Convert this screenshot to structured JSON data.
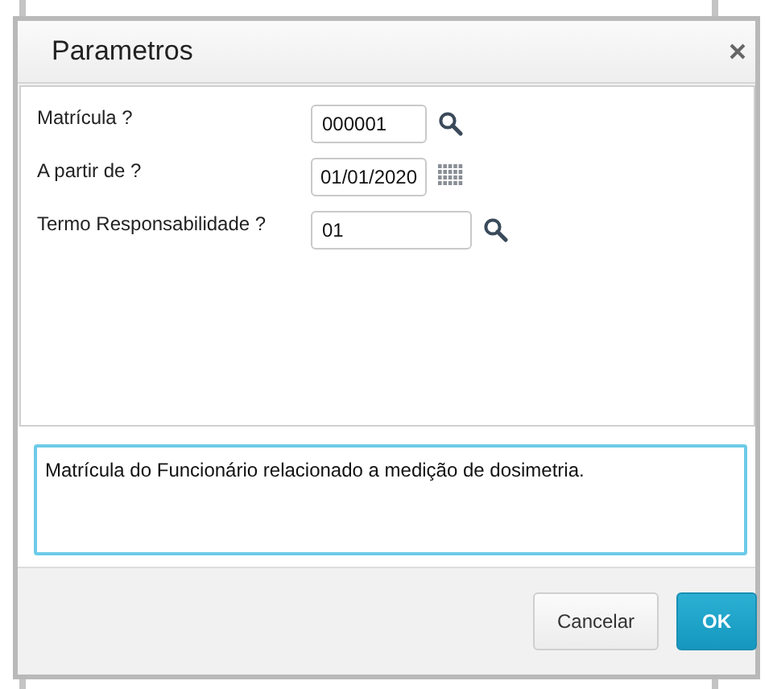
{
  "dialog": {
    "title": "Parametros"
  },
  "parameters": [
    {
      "label": "Matrícula ?",
      "value": "000001",
      "kind": "code"
    },
    {
      "label": "A partir de ?",
      "value": "01/01/2020",
      "kind": "date"
    },
    {
      "label": "Termo Responsabilidade ?",
      "value": "01",
      "kind": "lookup"
    }
  ],
  "help_text": "Matrícula do Funcionário relacionado a medição de dosimetria.",
  "buttons": [
    {
      "label": "Cancelar",
      "kind": "secondary"
    },
    {
      "label": "OK",
      "kind": "primary"
    }
  ]
}
